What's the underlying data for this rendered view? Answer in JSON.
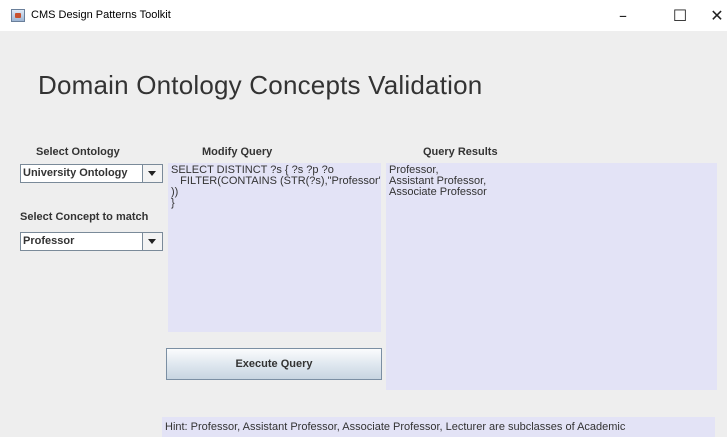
{
  "window": {
    "title": "CMS Design Patterns Toolkit",
    "minimize_glyph": "–",
    "maximize_glyph": "☐",
    "close_glyph": "✕"
  },
  "page_title": "Domain Ontology Concepts Validation",
  "ontology": {
    "label": "Select Ontology",
    "selected": "University Ontology"
  },
  "concept": {
    "label": "Select Concept to match",
    "selected": "Professor"
  },
  "query": {
    "label": "Modify Query",
    "text": "SELECT DISTINCT ?s { ?s ?p ?o\n   FILTER(CONTAINS (STR(?s),\"Professor\"\n))\n}"
  },
  "results": {
    "label": "Query Results",
    "text": "Professor,\nAssistant Professor,\nAssociate Professor"
  },
  "execute_button": "Execute Query",
  "hint": "Hint: Professor, Assistant Professor, Associate Professor, Lecturer are subclasses of Academic"
}
